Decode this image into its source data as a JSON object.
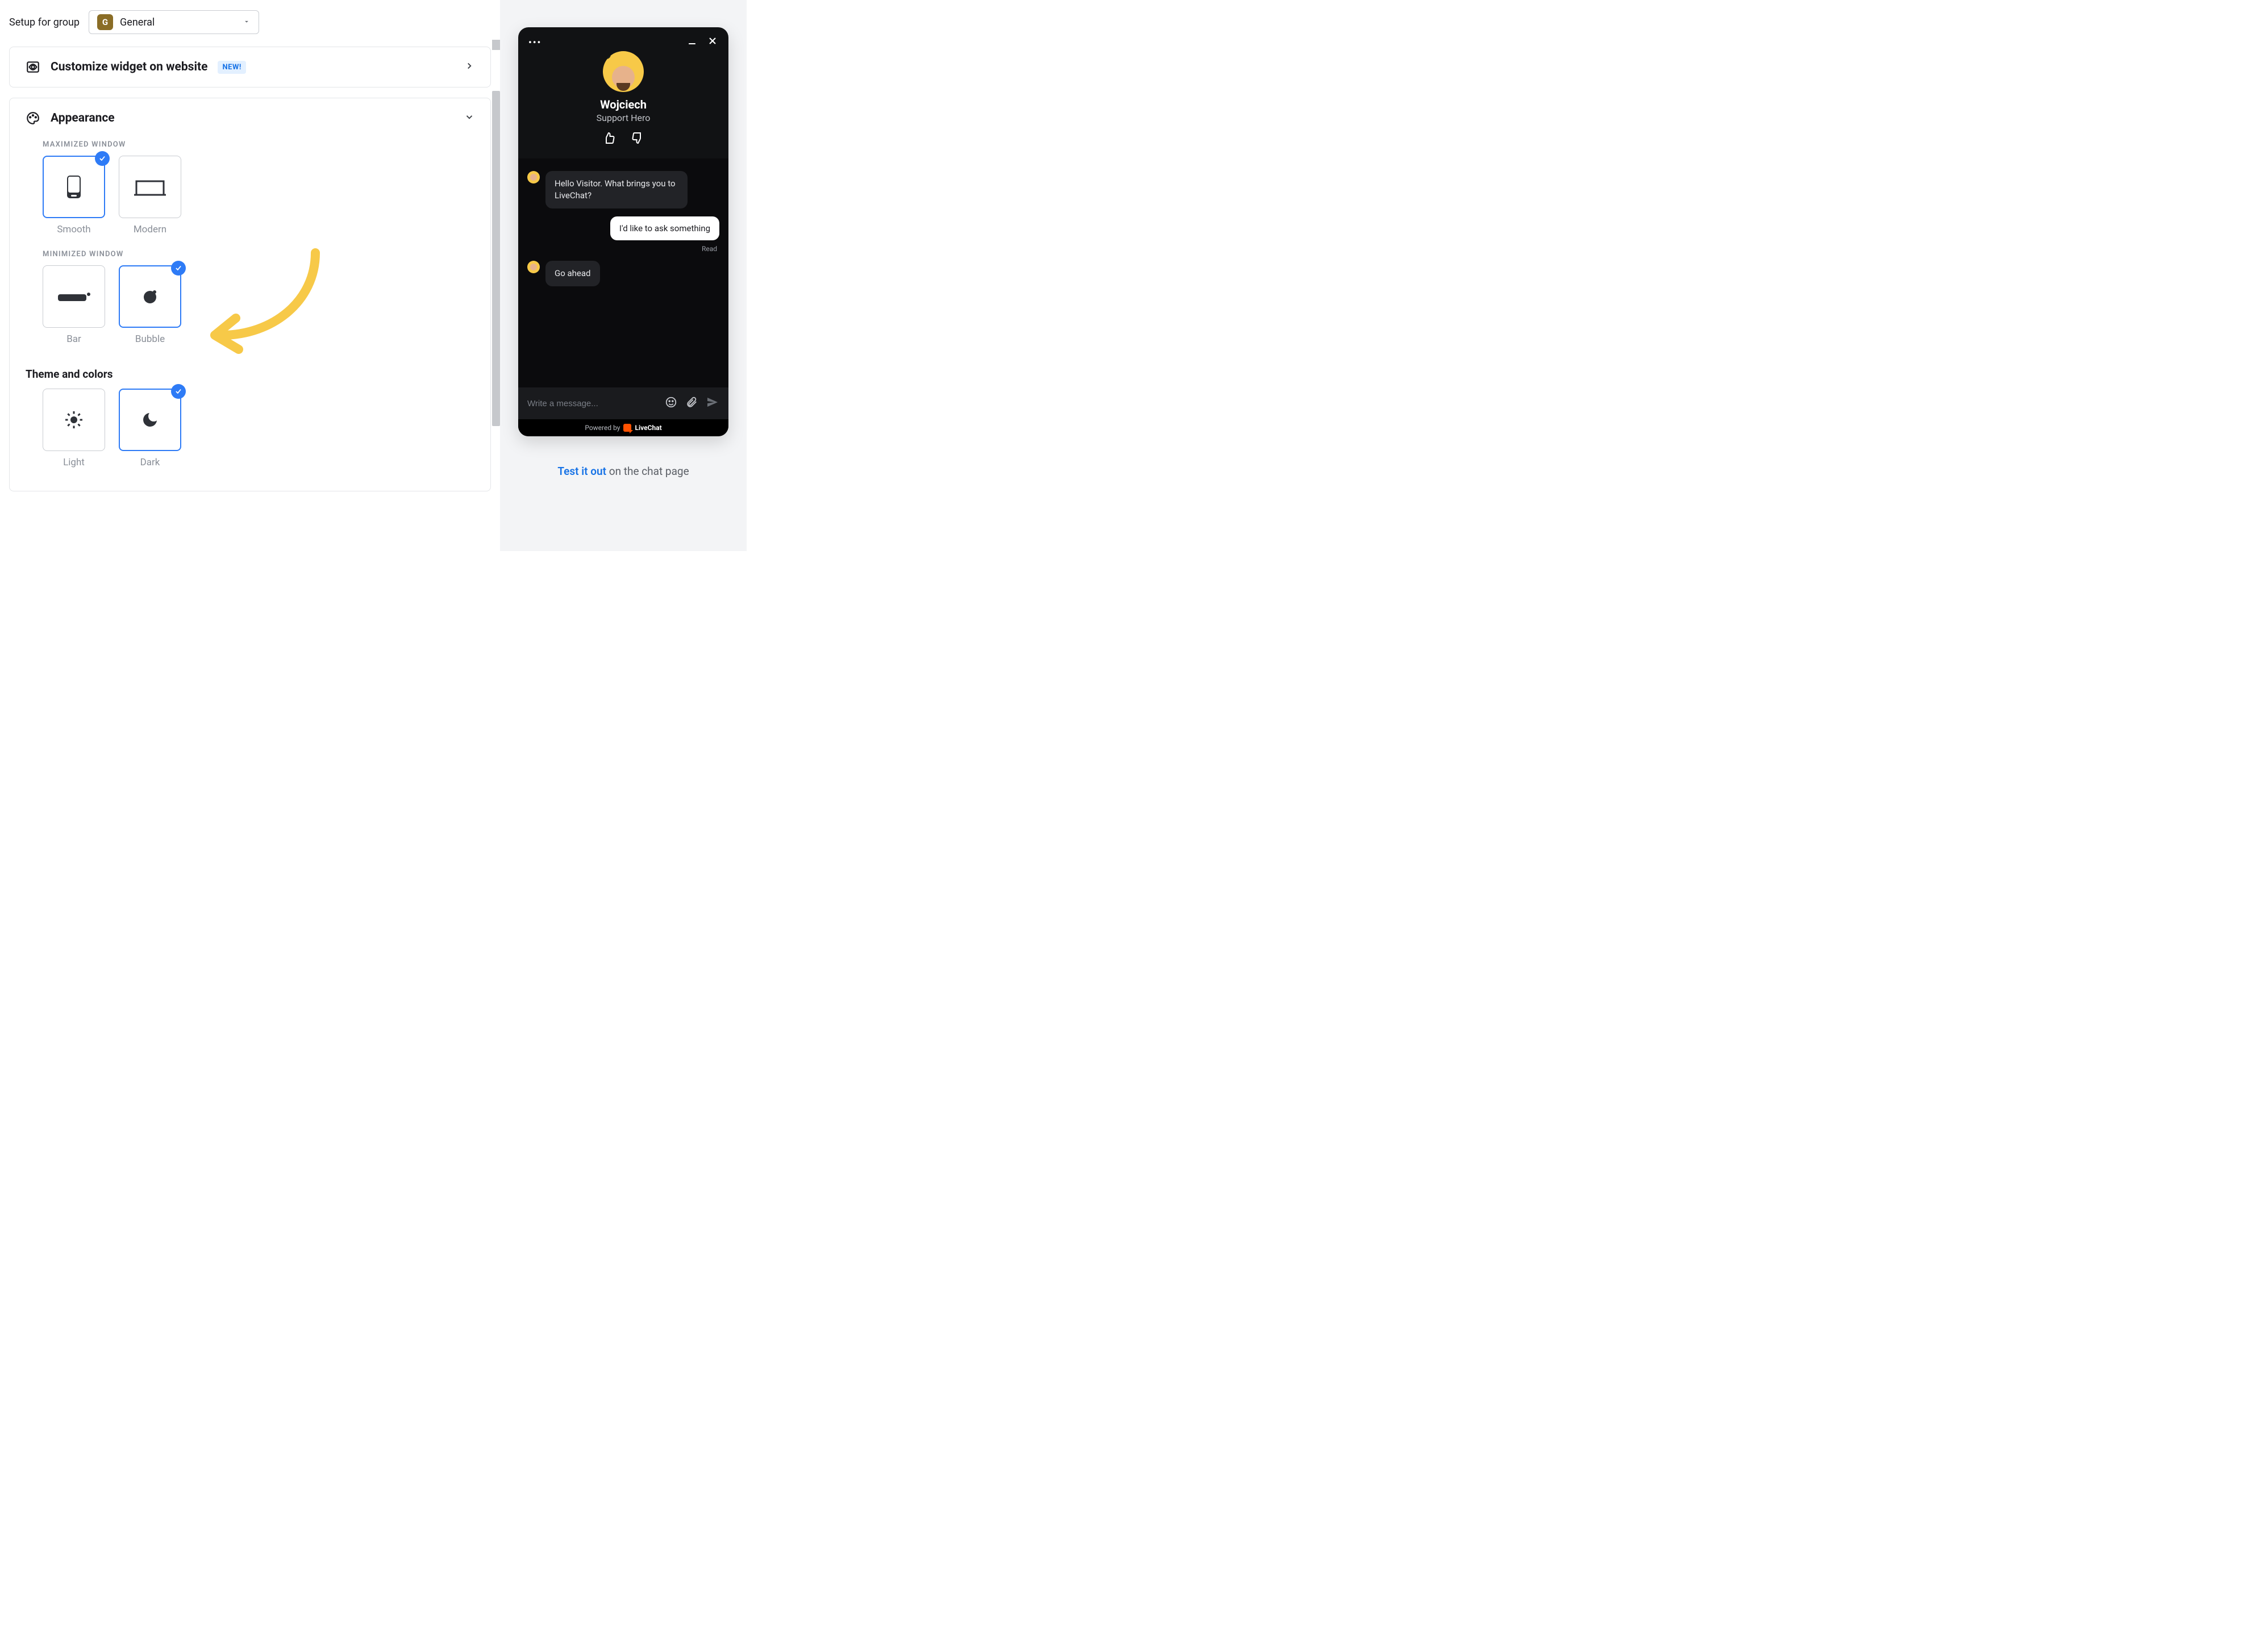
{
  "setupLabel": "Setup for group",
  "group": {
    "badge": "G",
    "name": "General"
  },
  "customizeCard": {
    "title": "Customize widget on website",
    "badge": "NEW!"
  },
  "appearance": {
    "title": "Appearance",
    "maximizedLabel": "MAXIMIZED WINDOW",
    "maximized": {
      "smooth": "Smooth",
      "modern": "Modern",
      "selected": "smooth"
    },
    "minimizedLabel": "MINIMIZED WINDOW",
    "minimized": {
      "bar": "Bar",
      "bubble": "Bubble",
      "selected": "bubble"
    },
    "themeTitle": "Theme and colors",
    "theme": {
      "light": "Light",
      "dark": "Dark",
      "selected": "dark"
    }
  },
  "preview": {
    "agentName": "Wojciech",
    "agentRole": "Support Hero",
    "messages": {
      "agent1": "Hello Visitor. What brings you to LiveChat?",
      "visitor1": "I'd like to ask something",
      "readStatus": "Read",
      "agent2": "Go ahead"
    },
    "inputPlaceholder": "Write a message...",
    "poweredByPrefix": "Powered by",
    "poweredByBrand": "LiveChat"
  },
  "testLine": {
    "link": "Test it out",
    "rest": " on the chat page"
  }
}
